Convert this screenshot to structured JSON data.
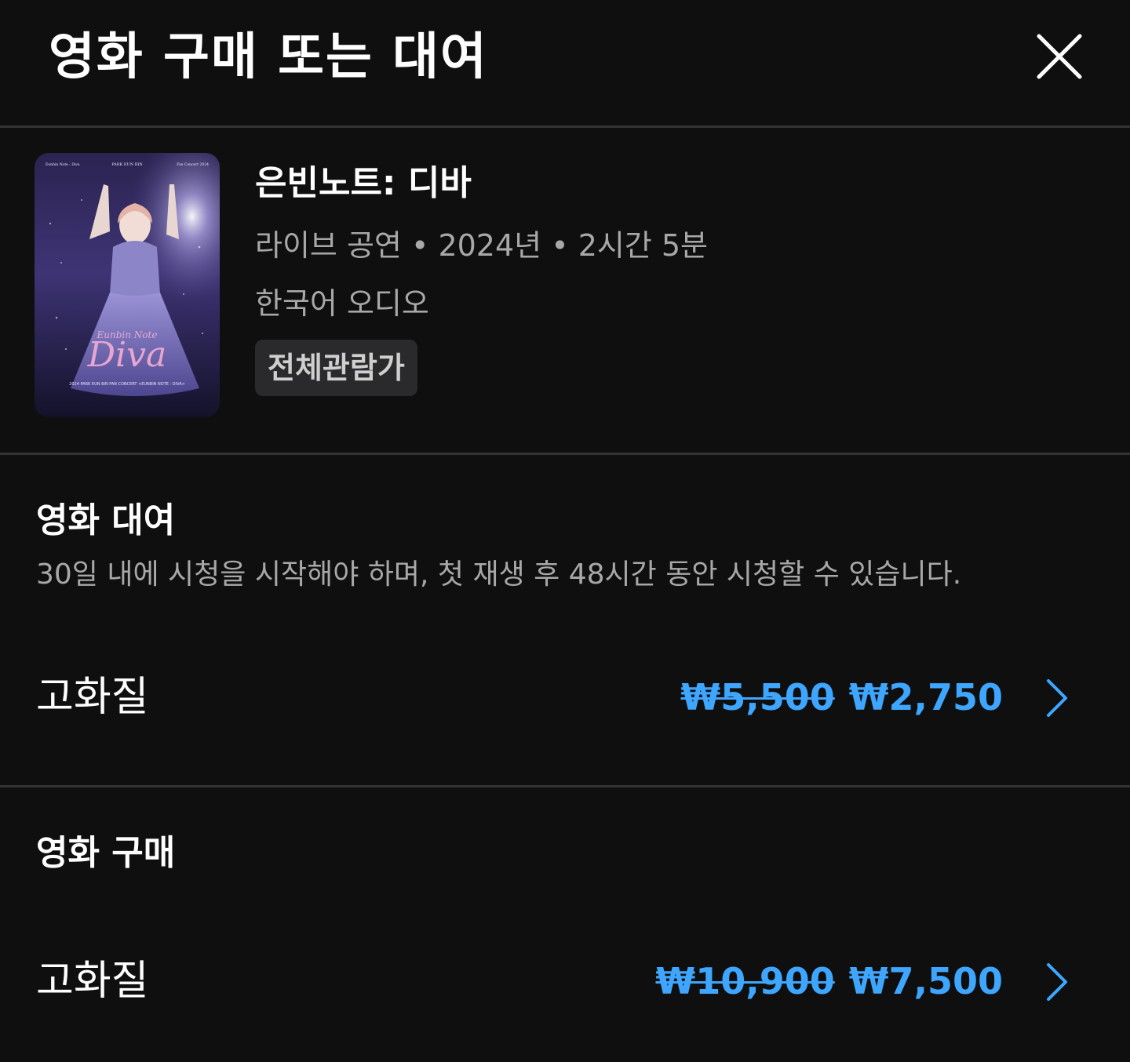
{
  "header": {
    "title": "영화 구매 또는 대여"
  },
  "movie": {
    "title": "은빈노트: 디바",
    "meta": "라이브 공연 • 2024년 • 2시간 5분",
    "audio": "한국어 오디오",
    "rating": "전체관람가",
    "poster": {
      "top_left_text": "Eunbin Note : Diva",
      "top_center_text": "PARK EUN BIN",
      "top_right_text": "Fan Concert 2024",
      "script_title": "Diva",
      "script_subtitle": "Eunbin Note",
      "caption": "2024 PARK EUN BIN FAN CONCERT <EUNBIN NOTE : DIVA>"
    }
  },
  "rental": {
    "title": "영화 대여",
    "description": "30일 내에 시청을 시작해야 하며, 첫 재생 후 48시간 동안 시청할 수 있습니다.",
    "option": {
      "label": "고화질",
      "old_price": "₩5,500",
      "price": "₩2,750"
    }
  },
  "purchase": {
    "title": "영화 구매",
    "option": {
      "label": "고화질",
      "old_price": "₩10,900",
      "price": "₩7,500"
    }
  },
  "colors": {
    "background": "#0f0f0f",
    "accent": "#3ea6ff",
    "secondary_text": "#a8a8a8",
    "divider": "#333335"
  },
  "icons": {
    "close": "close-icon",
    "chevron": "chevron-right-icon"
  }
}
